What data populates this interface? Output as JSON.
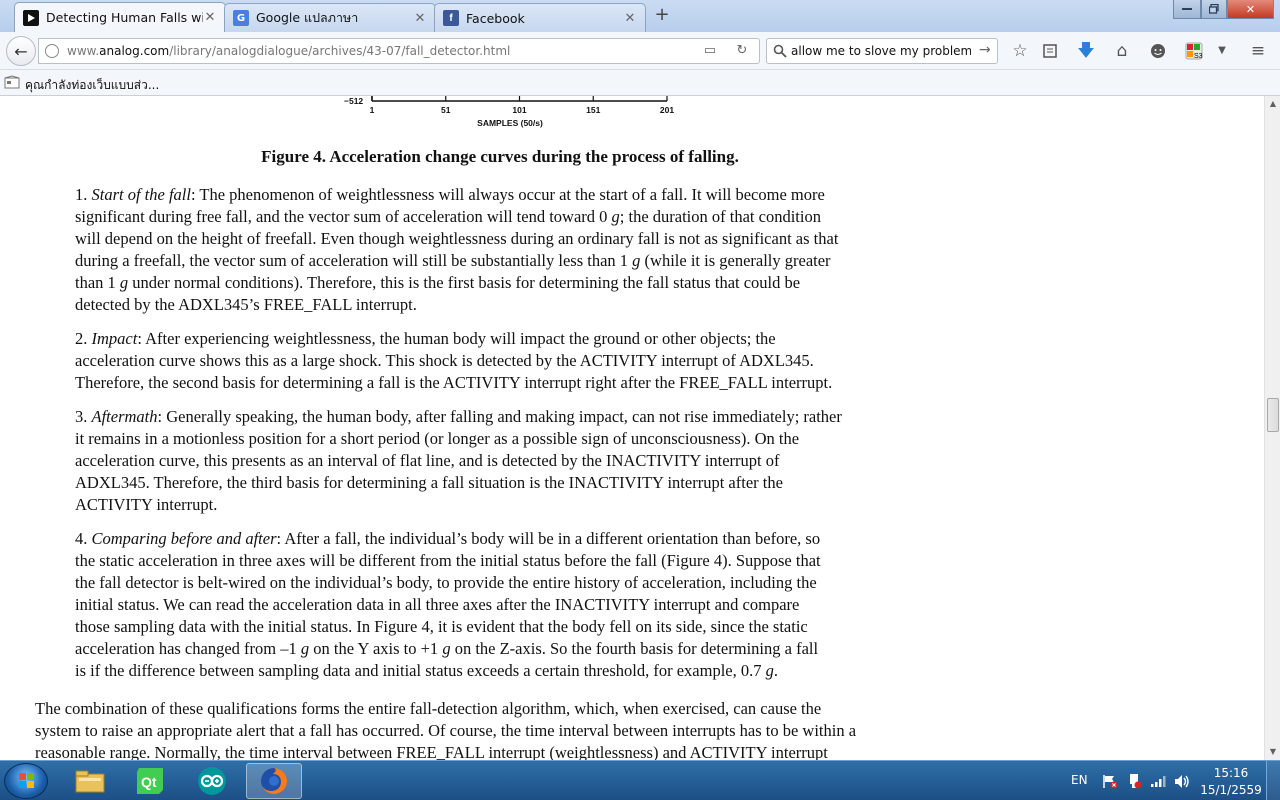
{
  "browser": {
    "tabs": [
      {
        "title": "Detecting Human Falls wit...",
        "favicon": "play-icon",
        "active": true
      },
      {
        "title": "Google แปลภาษา",
        "favicon": "google-icon",
        "active": false
      },
      {
        "title": "Facebook",
        "favicon": "facebook-icon",
        "active": false
      }
    ],
    "url": {
      "prefix": "www.",
      "domain": "analog.com",
      "path": "/library/analogdialogue/archives/43-07/fall_detector.html"
    },
    "search_value": "allow me to slove my problem.",
    "bookmark_label": "คุณกำลังท่องเว็บแบบส่ว..."
  },
  "figure": {
    "y_min_label": "−512",
    "x_ticks": [
      "1",
      "51",
      "101",
      "151",
      "201"
    ],
    "xlabel": "SAMPLES (50/s)",
    "caption": "Figure 4. Acceleration change curves during the process of falling."
  },
  "article": {
    "items": [
      {
        "num": "1. ",
        "lines": [
          "<i>Start of the fall</i>: The phenomenon of weightlessness will always occur at the start of a fall. It will become more",
          "significant during free fall, and the vector sum of acceleration will tend toward 0 <i>g</i>; the duration of that condition",
          "will depend on the height of freefall. Even though weightlessness during an ordinary fall is not as significant as that",
          "during a freefall, the vector sum of acceleration will still be substantially less than 1 <i>g</i> (while it is generally greater",
          "than 1 <i>g</i> under normal conditions). Therefore, this is the first basis for determining the fall status that could be",
          "detected by the ADXL345’s FREE_FALL interrupt."
        ]
      },
      {
        "num": "2. ",
        "lines": [
          "<i>Impact</i>: After experiencing weightlessness, the human body will impact the ground or other objects; the",
          "acceleration curve shows this as a large shock. This shock is detected by the ACTIVITY interrupt of ADXL345.",
          "Therefore, the second basis for determining a fall is the ACTIVITY interrupt right after the FREE_FALL interrupt."
        ]
      },
      {
        "num": "3. ",
        "lines": [
          "<i>Aftermath</i>: Generally speaking, the human body, after falling and making impact, can not rise immediately; rather",
          "it remains in a motionless position for a short period (or longer as a possible sign of unconsciousness). On the",
          "acceleration curve, this presents as an interval of flat line, and is detected by the INACTIVITY interrupt of",
          "ADXL345. Therefore, the third basis for determining a fall situation is the INACTIVITY interrupt after the",
          "ACTIVITY interrupt."
        ]
      },
      {
        "num": "4. ",
        "lines": [
          "<i>Comparing before and after</i>: After a fall, the individual’s body will be in a different orientation than before, so",
          "the static acceleration in three axes will be different from the initial status before the fall (Figure 4). Suppose that",
          "the fall detector is belt-wired on the individual’s body, to provide the entire history of acceleration, including the",
          "initial status. We can read the acceleration data in all three axes after the INACTIVITY interrupt and compare",
          "those sampling data with the initial status. In Figure 4, it is evident that the body fell on its side, since the static",
          "acceleration has changed from –1 <i>g</i> on the Y axis to +1 <i>g</i> on the Z-axis. So the fourth basis for determining a fall",
          "is if the difference between sampling data and initial status exceeds a certain threshold, for example, 0.7 <i>g</i>."
        ]
      }
    ],
    "closing_lines": [
      "The combination of these qualifications forms the entire fall-detection algorithm, which, when exercised, can cause the",
      "system to raise an appropriate alert that a fall has occurred. Of course, the time interval between interrupts has to be within a",
      "reasonable range. Normally, the time interval between FREE_FALL interrupt (weightlessness) and ACTIVITY interrupt"
    ]
  },
  "taskbar": {
    "apps": [
      "file-explorer-icon",
      "qt-creator-icon",
      "arduino-icon",
      "firefox-icon"
    ],
    "language": "EN",
    "time": "15:16",
    "date": "15/1/2559"
  }
}
